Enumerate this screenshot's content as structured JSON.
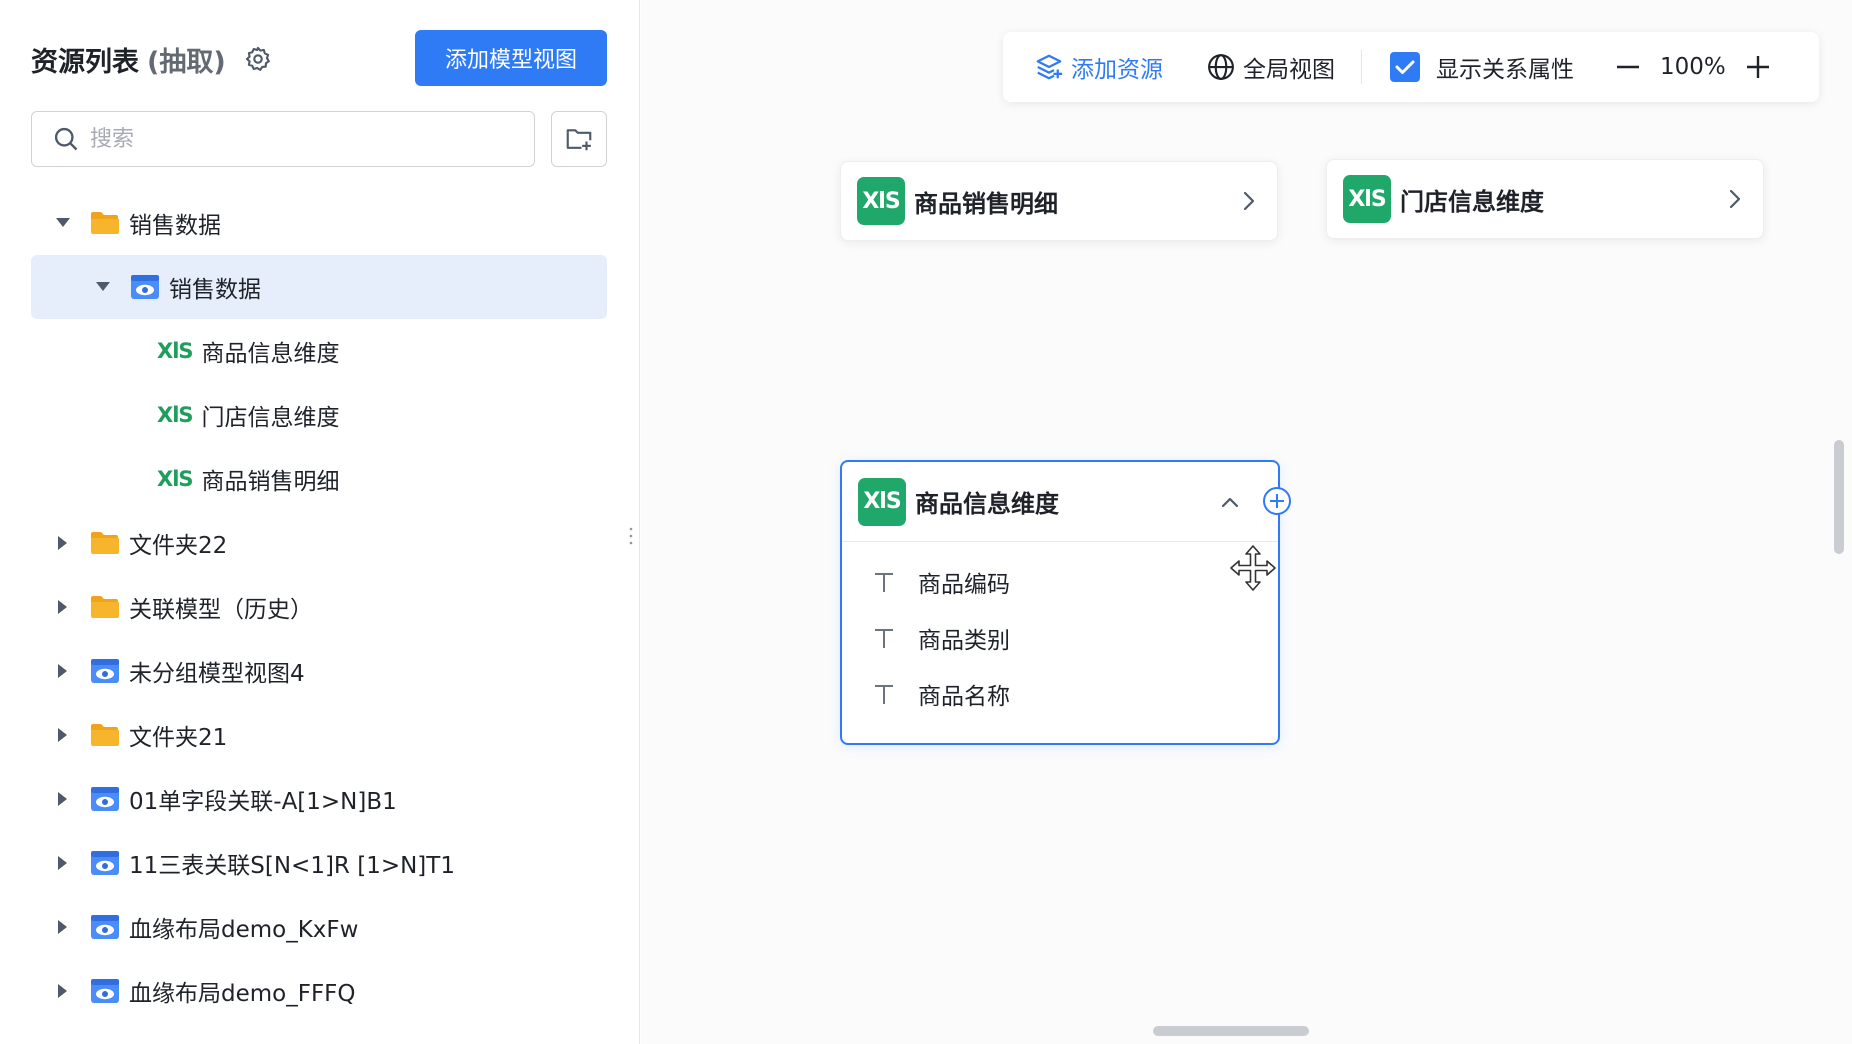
{
  "sidebar": {
    "title": "资源列表",
    "subtitle": "(抽取)",
    "add_view_button": "添加模型视图",
    "search": {
      "placeholder": "搜索",
      "value": ""
    },
    "tree": [
      {
        "label": "销售数据",
        "icon": "folder-open-icon",
        "expanded": true
      },
      {
        "label": "销售数据",
        "icon": "model-view-icon",
        "expanded": true,
        "selected": true
      },
      {
        "label": "商品信息维度",
        "icon": "xls-icon"
      },
      {
        "label": "门店信息维度",
        "icon": "xls-icon"
      },
      {
        "label": "商品销售明细",
        "icon": "xls-icon"
      },
      {
        "label": "文件夹22",
        "icon": "folder-icon"
      },
      {
        "label": "关联模型（历史）",
        "icon": "folder-icon"
      },
      {
        "label": "未分组模型视图4",
        "icon": "model-view-icon"
      },
      {
        "label": "文件夹21",
        "icon": "folder-icon"
      },
      {
        "label": "01单字段关联-A[1>N]B1",
        "icon": "model-view-icon"
      },
      {
        "label": "11三表关联S[N<1]R [1>N]T1",
        "icon": "model-view-icon"
      },
      {
        "label": "血缘布局demo_KxFw",
        "icon": "model-view-icon"
      },
      {
        "label": "血缘布局demo_FFFQ",
        "icon": "model-view-icon"
      }
    ],
    "xls_glyph": "XlS"
  },
  "toolbar": {
    "add_resource": "添加资源",
    "global_view": "全局视图",
    "show_relation_attrs": "显示关系属性",
    "show_relation_attrs_checked": true,
    "zoom": "100%"
  },
  "canvas": {
    "nodes": [
      {
        "title": "商品销售明细",
        "badge": "XlS"
      },
      {
        "title": "门店信息维度",
        "badge": "XlS"
      },
      {
        "title": "商品信息维度",
        "badge": "XlS",
        "expanded": true,
        "fields": [
          "商品编码",
          "商品类别",
          "商品名称"
        ]
      }
    ]
  },
  "colors": {
    "accent": "#2f7bf5",
    "xls_green": "#20a86b",
    "folder": "#f7b52c",
    "selected_bg": "#e6eefc"
  }
}
